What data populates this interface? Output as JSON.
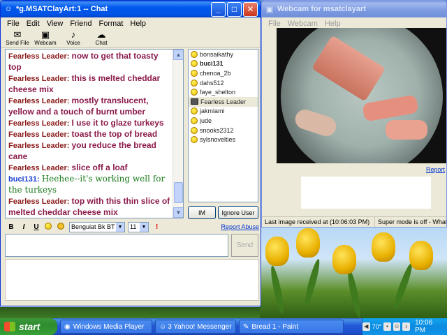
{
  "chat_window": {
    "title": "*g.MSATClayArt:1 -- Chat",
    "menu": [
      "File",
      "Edit",
      "View",
      "Friend",
      "Format",
      "Help"
    ],
    "toolbar": [
      {
        "label": "Send File",
        "icon": "send-file-icon"
      },
      {
        "label": "Webcam",
        "icon": "webcam-icon"
      },
      {
        "label": "Voice",
        "icon": "microphone-icon"
      },
      {
        "label": "Chat",
        "icon": "chat-bubble-icon"
      }
    ],
    "messages": [
      {
        "user": "Fearless Leader:",
        "text": "now to get that toasty top",
        "style": "fl"
      },
      {
        "user": "Fearless Leader:",
        "text": "this is melted cheddar cheese mix",
        "style": "fl"
      },
      {
        "user": "Fearless Leader:",
        "text": "mostly translucent, yellow and a touch of burnt umber",
        "style": "fl"
      },
      {
        "user": "Fearless Leader:",
        "text": "I use it to glaze turkeys",
        "style": "fl"
      },
      {
        "user": "Fearless Leader:",
        "text": "toast the top of bread",
        "style": "fl"
      },
      {
        "user": "Fearless Leader:",
        "text": "you reduce the bread cane",
        "style": "fl"
      },
      {
        "user": "Fearless Leader:",
        "text": "slice off a loaf",
        "style": "fl"
      },
      {
        "user": "buci131:",
        "text": "Heehee--it's working well for the turkeys",
        "style": "bu"
      },
      {
        "user": "Fearless Leader:",
        "text": "top with this thin slice of melted cheddar cheese mix",
        "style": "fl"
      }
    ],
    "users": [
      {
        "name": "bonsaikathy",
        "icon": "smiley"
      },
      {
        "name": "buci131",
        "icon": "smiley",
        "bold": true
      },
      {
        "name": "chenoa_2b",
        "icon": "smiley"
      },
      {
        "name": "dahs512",
        "icon": "smiley"
      },
      {
        "name": "faye_shelton",
        "icon": "smiley"
      },
      {
        "name": "Fearless Leader",
        "icon": "webcam",
        "selected": true
      },
      {
        "name": "jakmiami",
        "icon": "smiley"
      },
      {
        "name": "jude",
        "icon": "smiley"
      },
      {
        "name": "snooks2312",
        "icon": "smiley"
      },
      {
        "name": "sylsnovelties",
        "icon": "smiley"
      }
    ],
    "im_button": "IM",
    "ignore_button": "Ignore User",
    "format": {
      "bold": "B",
      "italic": "I",
      "underline": "U",
      "font": "Benguiat Bk BT",
      "size": "11"
    },
    "report_abuse": "Report Abuse",
    "send_button": "Send"
  },
  "webcam_window": {
    "title": "Webcam for msatclayart",
    "menu": [
      "File",
      "Webcam",
      "Help"
    ],
    "report_link": "Report",
    "status_left": "Last image received at (10:06:03 PM)",
    "status_right": "Super mode is off - What's"
  },
  "taskbar": {
    "start": "start",
    "tasks": [
      {
        "label": "Windows Media Player",
        "active": false
      },
      {
        "label": "3 Yahoo! Messenger",
        "active": false
      },
      {
        "label": "Bread 1 - Paint",
        "active": false
      }
    ],
    "clock": "10:06 PM",
    "tray_temp": "70°"
  },
  "colors": {
    "fearless_name": "#8b1a1a",
    "fearless_text": "#8b1a4a",
    "buci_name": "#1a3fd0",
    "buci_text": "#1a7a1a",
    "xp_blue": "#0058ee"
  }
}
